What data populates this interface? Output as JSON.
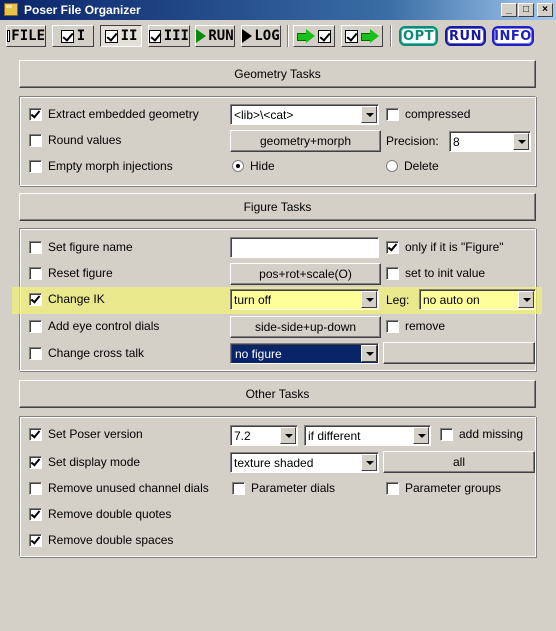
{
  "window": {
    "title": "Poser File Organizer"
  },
  "titlebar_buttons": {
    "minimize": "_",
    "maximize": "□",
    "close": "×"
  },
  "toolbar": {
    "file": "FILE",
    "pass1": "I",
    "pass2": "II",
    "pass3": "III",
    "run": "RUN",
    "log": "LOG",
    "opt": "OPT",
    "run2": "RUN",
    "info": "INFO"
  },
  "geometry": {
    "header": "Geometry Tasks",
    "extract": {
      "label": "Extract embedded geometry",
      "checked": true
    },
    "lib_combo": "<lib>\\<cat>",
    "compressed": {
      "label": "compressed",
      "checked": false
    },
    "round": {
      "label": "Round values",
      "checked": false
    },
    "geom_button": "geometry+morph",
    "precision_label": "Precision:",
    "precision_value": "8",
    "empty_morph": {
      "label": "Empty morph injections",
      "checked": false
    },
    "hide": {
      "label": "Hide",
      "selected": true
    },
    "delete": {
      "label": "Delete",
      "selected": false
    }
  },
  "figure": {
    "header": "Figure Tasks",
    "set_name": {
      "label": "Set figure name",
      "checked": false
    },
    "name_value": "",
    "only_if": {
      "label": "only if it is \"Figure\"",
      "checked": true
    },
    "reset": {
      "label": "Reset figure",
      "checked": false
    },
    "reset_button": "pos+rot+scale(O)",
    "init_value": {
      "label": "set to init value",
      "checked": false
    },
    "change_ik": {
      "label": "Change IK",
      "checked": true
    },
    "ik_value": "turn off",
    "leg_label": "Leg:",
    "leg_value": "no auto on",
    "eye": {
      "label": "Add eye control dials",
      "checked": false
    },
    "eye_button": "side-side+up-down",
    "remove": {
      "label": "remove",
      "checked": false
    },
    "cross": {
      "label": "Change cross talk",
      "checked": false
    },
    "cross_value": "no figure",
    "blank_button": ""
  },
  "other": {
    "header": "Other Tasks",
    "version": {
      "label": "Set Poser version",
      "checked": true
    },
    "version_value": "7.2",
    "version_mode": "if different",
    "add_missing": {
      "label": "add missing",
      "checked": false
    },
    "display": {
      "label": "Set display mode",
      "checked": true
    },
    "display_value": "texture shaded",
    "all_button": "all",
    "unused": {
      "label": "Remove unused channel dials",
      "checked": false
    },
    "param_dials": {
      "label": "Parameter dials",
      "checked": false
    },
    "param_groups": {
      "label": "Parameter groups",
      "checked": false
    },
    "dquotes": {
      "label": "Remove double quotes",
      "checked": true
    },
    "dspaces": {
      "label": "Remove double spaces",
      "checked": true
    }
  }
}
